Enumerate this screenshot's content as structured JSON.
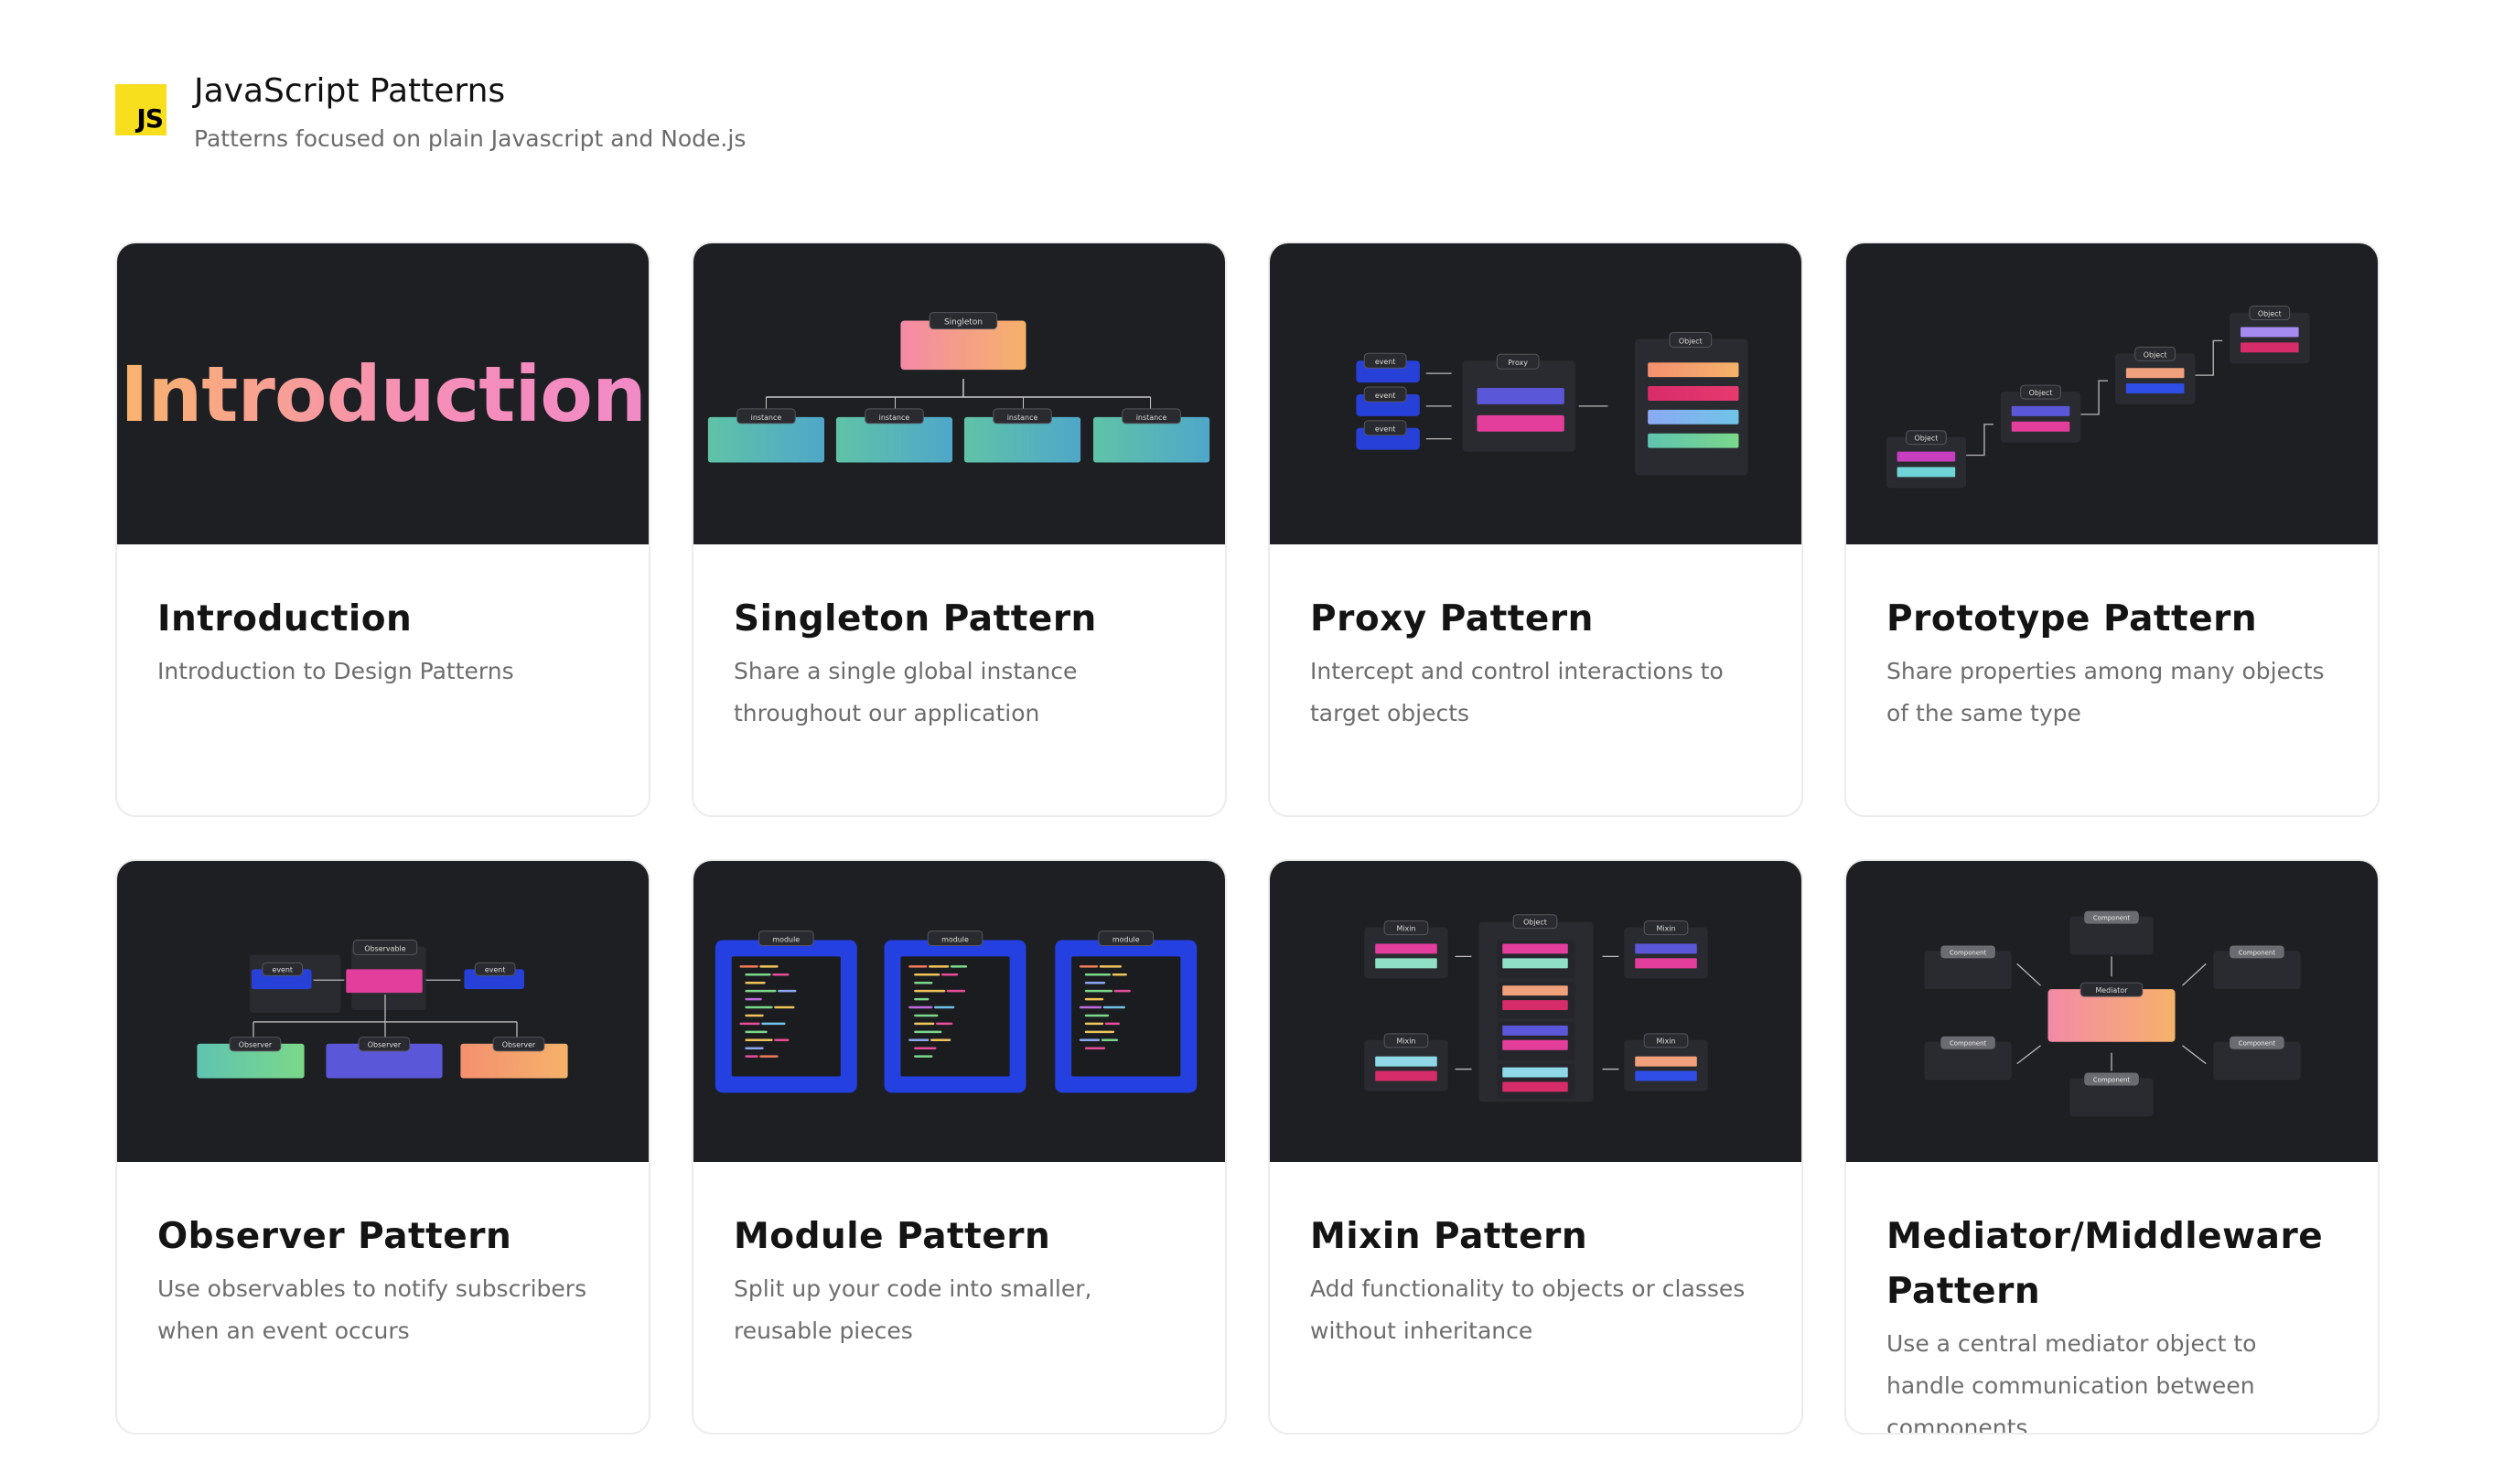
{
  "header": {
    "logo_text": "JS",
    "title": "JavaScript Patterns",
    "subtitle": "Patterns focused on plain Javascript and Node.js"
  },
  "colors": {
    "card_bg_dark": "#1e1f23",
    "js_yellow": "#f7df1e",
    "accent_pink": "#e83e9b",
    "accent_blue": "#2f4ee8",
    "accent_teal": "#5fc3b0",
    "accent_orange": "#f6a35a"
  },
  "cards": [
    {
      "title": "Introduction",
      "description": "Introduction to Design Patterns",
      "image": {
        "word": "Introduction"
      }
    },
    {
      "title": "Singleton Pattern",
      "description": "Share a single global instance throughout our application",
      "image": {
        "root": "Singleton",
        "children": [
          "instance",
          "instance",
          "instance",
          "instance"
        ]
      }
    },
    {
      "title": "Proxy Pattern",
      "description": "Intercept and control interactions to target objects",
      "image": {
        "events": [
          "event",
          "event",
          "event"
        ],
        "proxy": "Proxy",
        "target": "Object"
      }
    },
    {
      "title": "Prototype Pattern",
      "description": "Share properties among many objects of the same type",
      "image": {
        "objects": [
          "Object",
          "Object",
          "Object",
          "Object"
        ]
      }
    },
    {
      "title": "Observer Pattern",
      "description": "Use observables to notify subscribers when an event occurs",
      "image": {
        "events": [
          "event",
          "event"
        ],
        "observable": "Observable",
        "observers": [
          "Observer",
          "Observer",
          "Observer"
        ]
      }
    },
    {
      "title": "Module Pattern",
      "description": "Split up your code into smaller, reusable pieces",
      "image": {
        "modules": [
          "module",
          "module",
          "module"
        ]
      }
    },
    {
      "title": "Mixin Pattern",
      "description": "Add functionality to objects or classes without inheritance",
      "image": {
        "object": "Object",
        "mixins": [
          "Mixin",
          "Mixin",
          "Mixin",
          "Mixin"
        ]
      }
    },
    {
      "title": "Mediator/Middleware Pattern",
      "description": "Use a central mediator object to handle communication between components",
      "image": {
        "mediator": "Mediator",
        "components": [
          "Component",
          "Component",
          "Component",
          "Component",
          "Component",
          "Component"
        ]
      }
    }
  ]
}
